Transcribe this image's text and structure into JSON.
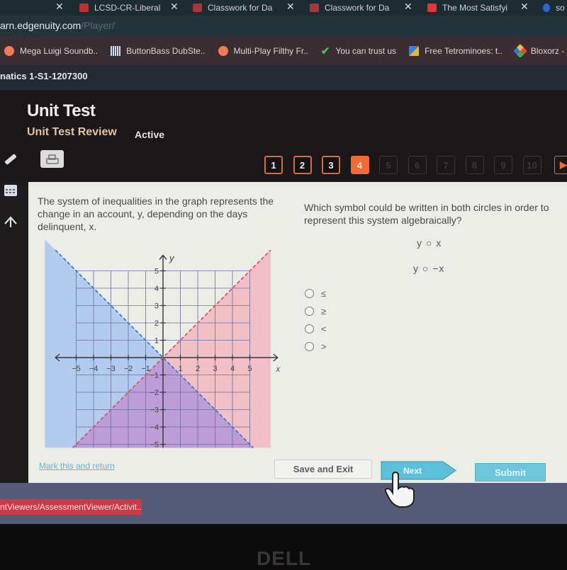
{
  "browser": {
    "tabs": [
      {
        "label": "LCSD-CR-Liberal",
        "favicon": "red-ribbon"
      },
      {
        "label": "Classwork for Da",
        "favicon": "classroom"
      },
      {
        "label": "Classwork for Da",
        "favicon": "classroom"
      },
      {
        "label": "The Most Satisfyi",
        "favicon": "youtube"
      },
      {
        "label": "so",
        "favicon": "blue-drop"
      }
    ],
    "url_host": "arn.edgenuity.com",
    "url_path": "/Player/",
    "bookmarks": [
      {
        "label": "Mega Luigi Soundb..",
        "icon": "orange-s"
      },
      {
        "label": "ButtonBass DubSte..",
        "icon": "piano-keys"
      },
      {
        "label": "Multi-Play Filthy Fr..",
        "icon": "orange-s"
      },
      {
        "label": "You can trust us",
        "icon": "green-check"
      },
      {
        "label": "Free Tetrominoes: t..",
        "icon": "tetris-blocks"
      },
      {
        "label": "Bloxorz - F",
        "icon": "bloxorz"
      }
    ]
  },
  "course": "natics 1-S1-1207300",
  "header": {
    "title": "Unit Test",
    "subtitle": "Unit Test Review",
    "status": "Active"
  },
  "question_nav": {
    "items": [
      "1",
      "2",
      "3",
      "4",
      "5",
      "6",
      "7",
      "8",
      "9",
      "10"
    ],
    "completed": [
      "1",
      "2",
      "3"
    ],
    "current": "4",
    "next_arrow": "▶"
  },
  "left_tools": [
    "pencil-icon",
    "calculator-icon",
    "up-arrow-icon"
  ],
  "stem": {
    "text": "The system of inequalities in the graph represents the change in an account, y, depending on the days delinquent, x."
  },
  "question": {
    "text": "Which symbol could be written in both circles in order to represent this system algebraically?",
    "expr1": "y ○ x",
    "expr2": "y ○ −x",
    "options": [
      "≤",
      "≥",
      "<",
      ">"
    ]
  },
  "graph": {
    "x_label": "x",
    "y_label": "y",
    "x_ticks": [
      "−5",
      "−4",
      "−3",
      "−2",
      "−1",
      "1",
      "2",
      "3",
      "4",
      "5"
    ],
    "y_ticks": [
      "5",
      "4",
      "3",
      "2",
      "1",
      "−1",
      "−2",
      "−3",
      "−4",
      "−5"
    ],
    "range": [
      -5,
      5
    ],
    "lines": [
      {
        "name": "y = x",
        "style": "dashed",
        "color": "#e0506a",
        "shade": "below-right"
      },
      {
        "name": "y = -x",
        "style": "dashed",
        "color": "#4a76c8",
        "shade": "below-left"
      }
    ],
    "colors": {
      "red_fill": "#f2b6c0",
      "blue_fill": "#a9c4ee",
      "overlap_fill": "#b89ad8"
    }
  },
  "footer": {
    "mark_link": "Mark this and return",
    "save_exit": "Save and Exit",
    "next": "Next",
    "submit": "Submit"
  },
  "status_url": "ntViewers/AssessmentViewer/Activit...",
  "bezel_brand": "DELL",
  "colors": {
    "accent_orange": "#f06a3a",
    "next_blue": "#5cc0d8",
    "link_blue": "#6db0c8"
  }
}
